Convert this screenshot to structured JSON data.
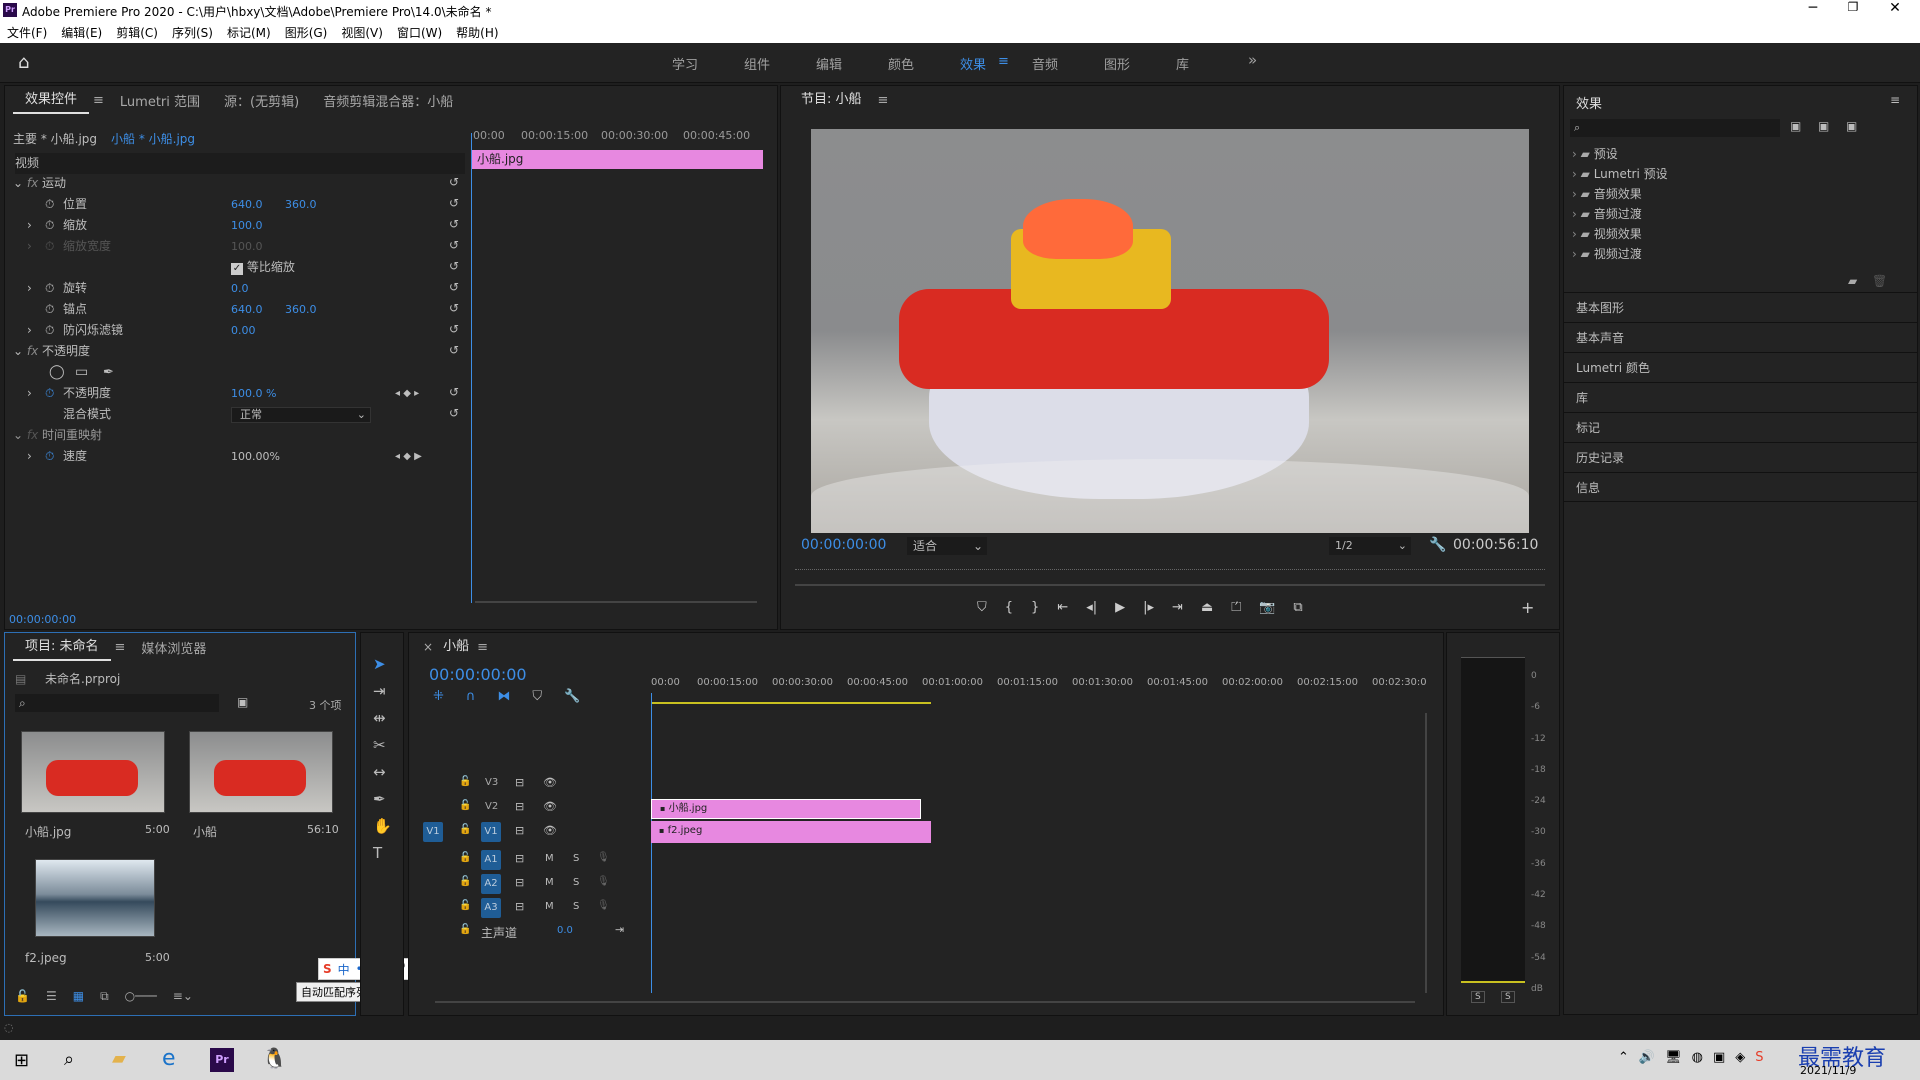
{
  "app": {
    "title": "Adobe Premiere Pro 2020 - C:\\用户\\hbxy\\文档\\Adobe\\Premiere Pro\\14.0\\未命名 *",
    "logo": "Pr"
  },
  "menu": [
    "文件(F)",
    "编辑(E)",
    "剪辑(C)",
    "序列(S)",
    "标记(M)",
    "图形(G)",
    "视图(V)",
    "窗口(W)",
    "帮助(H)"
  ],
  "workspaces": [
    "学习",
    "组件",
    "编辑",
    "颜色",
    "效果",
    "音频",
    "图形",
    "库"
  ],
  "workspace_active": "效果",
  "effect_controls": {
    "tabs": [
      "效果控件",
      "Lumetri 范围",
      "源：(无剪辑)",
      "音频剪辑混合器：小船"
    ],
    "master": "主要 * 小船.jpg",
    "clip": "小船 * 小船.jpg",
    "ruler": [
      "00:00",
      "00:00:15:00",
      "00:00:30:00",
      "00:00:45:00"
    ],
    "clip_bar": "小船.jpg",
    "section_video": "视频",
    "motion": "运动",
    "position": {
      "label": "位置",
      "x": "640.0",
      "y": "360.0"
    },
    "scale": {
      "label": "缩放",
      "v": "100.0"
    },
    "scale_width": {
      "label": "缩放宽度",
      "v": "100.0"
    },
    "uniform": "等比缩放",
    "rotation": {
      "label": "旋转",
      "v": "0.0"
    },
    "anchor": {
      "label": "锚点",
      "x": "640.0",
      "y": "360.0"
    },
    "antiflicker": {
      "label": "防闪烁滤镜",
      "v": "0.00"
    },
    "opacity_section": "不透明度",
    "opacity": {
      "label": "不透明度",
      "v": "100.0 %"
    },
    "blend": {
      "label": "混合模式",
      "v": "正常"
    },
    "time_remap": "时间重映射",
    "speed": {
      "label": "速度",
      "v": "100.00%"
    },
    "timecode": "00:00:00:00"
  },
  "program": {
    "tab": "节目: 小船",
    "timecode": "00:00:00:00",
    "fit": "适合",
    "quality": "1/2",
    "duration": "00:00:56:10"
  },
  "effects": {
    "title": "效果",
    "tree": [
      "预设",
      "Lumetri 预设",
      "音频效果",
      "音频过渡",
      "视频效果",
      "视频过渡"
    ],
    "panels": [
      "基本图形",
      "基本声音",
      "Lumetri 颜色",
      "库",
      "标记",
      "历史记录",
      "信息"
    ]
  },
  "project": {
    "tabs": [
      "项目: 未命名",
      "媒体浏览器"
    ],
    "file": "未命名.prproj",
    "count": "3 个项",
    "items": [
      {
        "name": "小船.jpg",
        "dur": "5:00"
      },
      {
        "name": "小船",
        "dur": "56:10"
      },
      {
        "name": "f2.jpeg",
        "dur": "5:00"
      }
    ],
    "tooltip": "自动匹配序列(A)..."
  },
  "timeline": {
    "tab": "小船",
    "timecode": "00:00:00:00",
    "ruler": [
      "00:00",
      "00:00:15:00",
      "00:00:30:00",
      "00:00:45:00",
      "00:01:00:00",
      "00:01:15:00",
      "00:01:30:00",
      "00:01:45:00",
      "00:02:00:00",
      "00:02:15:00",
      "00:02:30:0"
    ],
    "tracks_video": [
      "V3",
      "V2",
      "V1"
    ],
    "tracks_audio": [
      "A1",
      "A2",
      "A3"
    ],
    "source_v1": "V1",
    "master": "主声道",
    "master_val": "0.0",
    "clip_v2": "小船.jpg",
    "clip_v1": "f2.jpeg",
    "m": "M",
    "s": "S"
  },
  "meter": {
    "levels": [
      "0",
      "-6",
      "-12",
      "-18",
      "-24",
      "-30",
      "-36",
      "-42",
      "-48",
      "-54",
      "dB"
    ],
    "s1": "S",
    "s2": "S"
  },
  "ime": {
    "lang": "中"
  },
  "taskbar": {
    "date": "2021/11/9",
    "watermark": "最需教育"
  },
  "colors": {
    "accent": "#3d8ee6",
    "clip": "#e788e0",
    "panel": "#232323"
  }
}
